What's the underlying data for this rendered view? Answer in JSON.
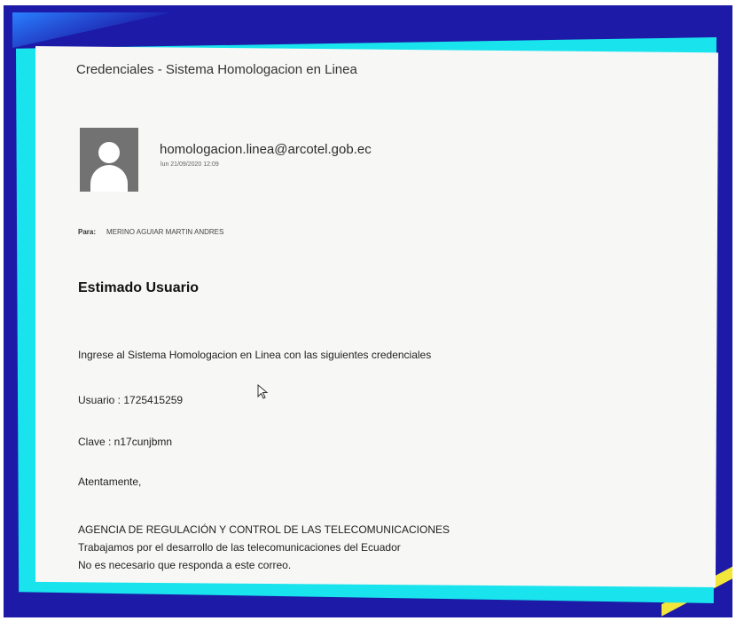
{
  "email": {
    "subject": "Credenciales - Sistema Homologacion en Linea",
    "sender": "homologacion.linea@arcotel.gob.ec",
    "date": "lun 21/09/2020 12:09",
    "to_label": "Para:",
    "to_value": "MERINO AGUIAR MARTIN ANDRES",
    "greeting": "Estimado Usuario",
    "intro": "Ingrese al Sistema Homologacion en Linea con las siguientes credenciales",
    "usuario": "Usuario : 1725415259",
    "clave": "Clave : n17cunjbmn",
    "closing": "Atentamente,",
    "signature_line1": "AGENCIA DE REGULACIÓN Y CONTROL DE LAS TELECOMUNICACIONES",
    "signature_line2": "Trabajamos por el desarrollo de las telecomunicaciones del Ecuador",
    "signature_line3": "No es necesario que responda a este correo."
  },
  "icons": {
    "avatar": "person-silhouette-icon",
    "cursor": "mouse-pointer-icon"
  },
  "colors": {
    "frame": "#1c1aa6",
    "accent": "#19e3ec",
    "highlight": "#f2e63a"
  }
}
